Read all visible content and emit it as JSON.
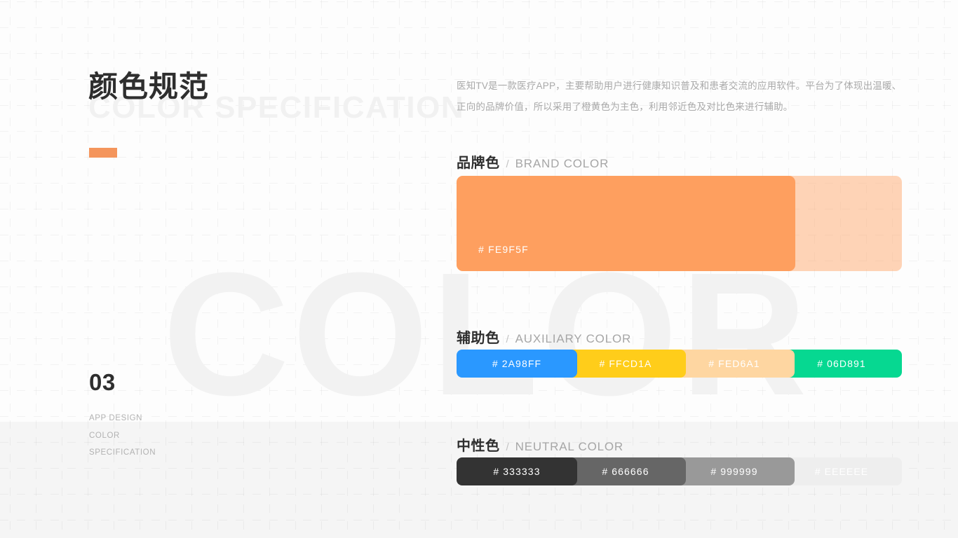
{
  "page": {
    "background": "#fcfcfc",
    "watermark_text": "COLOR"
  },
  "header": {
    "title_cn": "颜色规范",
    "title_en_ghost": "COLOR SPECIFICATION",
    "intro": "医知TV是一款医疗APP，主要帮助用户进行健康知识普及和患者交流的应用软件。平台为了体现出温暖、正向的品牌价值，所以采用了橙黄色为主色，利用邻近色及对比色来进行辅助。",
    "accent_color": "#F4955C"
  },
  "index": {
    "number": "03",
    "line1": "APP DESIGN",
    "line2": "COLOR",
    "line3": "SPECIFICATION"
  },
  "sections": {
    "brand": {
      "heading_cn": "品牌色",
      "separator": "/",
      "heading_en": "BRAND COLOR",
      "swatch": {
        "label": "# FE9F5F",
        "color": "#FE9F5F"
      }
    },
    "auxiliary": {
      "heading_cn": "辅助色",
      "separator": "/",
      "heading_en": "AUXILIARY COLOR",
      "swatches": [
        {
          "label": "# 2A98FF",
          "color": "#2A98FF"
        },
        {
          "label": "# FFCD1A",
          "color": "#FFCD1A"
        },
        {
          "label": "# FED6A1",
          "color": "#FED6A1"
        },
        {
          "label": "# 06D891",
          "color": "#06D891"
        }
      ]
    },
    "neutral": {
      "heading_cn": "中性色",
      "separator": "/",
      "heading_en": "NEUTRAL COLOR",
      "swatches": [
        {
          "label": "# 333333",
          "color": "#333333"
        },
        {
          "label": "# 666666",
          "color": "#666666"
        },
        {
          "label": "# 999999",
          "color": "#999999"
        },
        {
          "label": "# EEEEEE",
          "color": "#EEEEEE"
        }
      ]
    }
  }
}
